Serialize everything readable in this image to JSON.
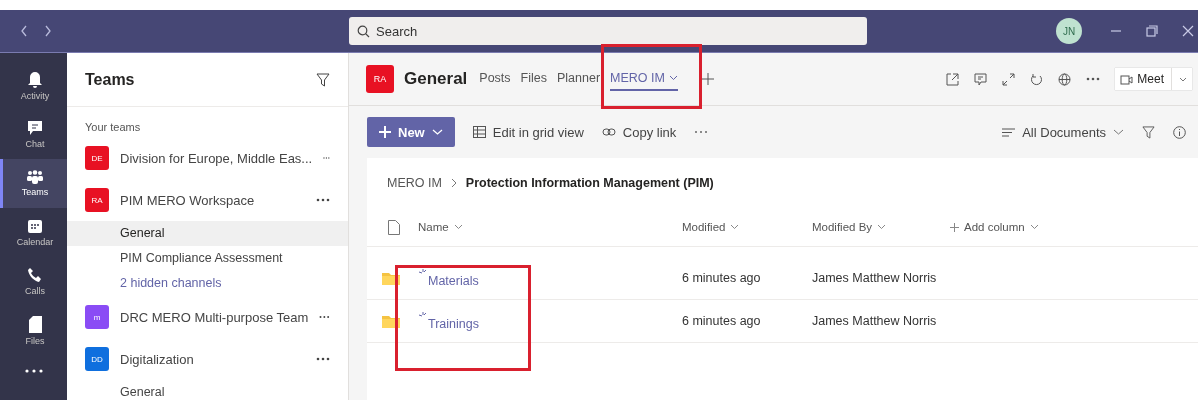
{
  "title_bar": {
    "search": {
      "placeholder": "Search"
    },
    "avatar": {
      "initials": "JN"
    }
  },
  "app_bar": [
    {
      "label": "Activity",
      "kind": "bell",
      "selected": false
    },
    {
      "label": "Chat",
      "kind": "chat",
      "selected": false
    },
    {
      "label": "Teams",
      "kind": "teams",
      "selected": true
    },
    {
      "label": "Calendar",
      "kind": "calendar",
      "selected": false
    },
    {
      "label": "Calls",
      "kind": "phone",
      "selected": false
    },
    {
      "label": "Files",
      "kind": "file",
      "selected": false
    }
  ],
  "teams_panel": {
    "title": "Teams",
    "section": "Your teams",
    "teams": [
      {
        "initials": "DE",
        "name": "Division for Europe, Middle Eas...",
        "color": "#e81123"
      },
      {
        "initials": "RA",
        "name": "PIM MERO Workspace",
        "color": "#e81123",
        "channels": [
          {
            "name": "General",
            "kind": "channel",
            "selected": true
          },
          {
            "name": "PIM Compliance Assessment",
            "kind": "channel",
            "selected": false
          },
          {
            "name": "2 hidden channels",
            "kind": "link",
            "selected": false
          }
        ]
      },
      {
        "initials": "m",
        "name": "DRC MERO Multi-purpose Team",
        "color": "#8a4cf5"
      },
      {
        "initials": "DD",
        "name": "Digitalization",
        "color": "#0f6fde",
        "channels": [
          {
            "name": "General",
            "kind": "channel",
            "selected": false
          }
        ]
      }
    ]
  },
  "channel_header": {
    "initials": "RA",
    "title": "General",
    "tabs": [
      {
        "label": "Posts",
        "selected": false,
        "highlighted": false
      },
      {
        "label": "Files",
        "selected": false,
        "highlighted": false
      },
      {
        "label": "Planner",
        "selected": false,
        "highlighted": false
      },
      {
        "label": "MERO IM",
        "selected": true,
        "highlighted": true
      }
    ],
    "meet": "Meet"
  },
  "toolbar": {
    "new": "New",
    "edit_grid": "Edit in grid view",
    "copy_link": "Copy link",
    "view": "All Documents"
  },
  "breadcrumb": {
    "parent": "MERO IM",
    "current": "Protection Information Management (PIM)"
  },
  "table": {
    "columns": [
      "Name",
      "Modified",
      "Modified By",
      "Add column"
    ],
    "names_highlighted": true,
    "rows": [
      {
        "name": "Materials",
        "modified": "6 minutes ago",
        "modified_by": "James Matthew Norris"
      },
      {
        "name": "Trainings",
        "modified": "6 minutes ago",
        "modified_by": "James Matthew Norris"
      }
    ]
  }
}
